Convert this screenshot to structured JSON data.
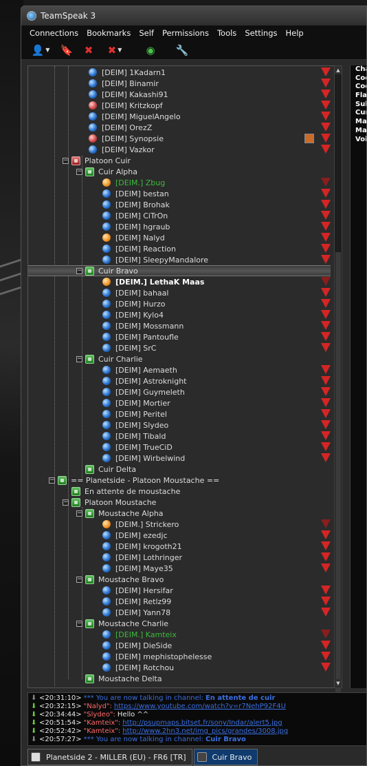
{
  "window": {
    "title": "TeamSpeak 3"
  },
  "menu": [
    "Connections",
    "Bookmarks",
    "Self",
    "Permissions",
    "Tools",
    "Settings",
    "Help"
  ],
  "toolbar": [
    {
      "name": "connect-icon",
      "glyph": "👤",
      "dropdown": true
    },
    {
      "name": "bookmark-icon",
      "glyph": "🔖",
      "dropdown": false
    },
    {
      "name": "disconnect-icon",
      "glyph": "✖",
      "dropdown": false
    },
    {
      "name": "disconnect-all-icon",
      "glyph": "✖",
      "dropdown": true
    },
    {
      "name": "away-icon",
      "glyph": "◉",
      "dropdown": false
    },
    {
      "name": "user-settings-icon",
      "glyph": "🔧",
      "dropdown": false
    }
  ],
  "tree": [
    {
      "type": "user",
      "level": 4,
      "label": "[DEIM] 1Kadarn1",
      "icon": "blue",
      "flag": true
    },
    {
      "type": "user",
      "level": 4,
      "label": "[DEIM] Binamir",
      "icon": "blue",
      "flag": true
    },
    {
      "type": "user",
      "level": 4,
      "label": "[DEIM] Kakashi91",
      "icon": "blue",
      "flag": true
    },
    {
      "type": "user",
      "level": 4,
      "label": "[DEIM] Kritzkopf",
      "icon": "away",
      "flag": true
    },
    {
      "type": "user",
      "level": 4,
      "label": "[DEIM] MiguelAngelo",
      "icon": "blue",
      "flag": true
    },
    {
      "type": "user",
      "level": 4,
      "label": "[DEIM] OrezZ",
      "icon": "blue",
      "flag": true
    },
    {
      "type": "user",
      "level": 4,
      "label": "[DEIM] Synopsie",
      "icon": "away",
      "flag": true,
      "badge": true
    },
    {
      "type": "user",
      "level": 4,
      "label": "[DEIM] Vazkor",
      "icon": "blue",
      "flag": true
    },
    {
      "type": "channel",
      "level": 2,
      "label": "Platoon Cuir",
      "icon": "red",
      "expanded": true
    },
    {
      "type": "channel",
      "level": 3,
      "label": "Cuir Alpha",
      "icon": "green",
      "expanded": true
    },
    {
      "type": "user",
      "level": 5,
      "label": "[DEIM.] Zbug",
      "icon": "orange",
      "flag": true,
      "style": "green",
      "flagdark": true
    },
    {
      "type": "user",
      "level": 5,
      "label": "[DEIM] bestan",
      "icon": "blue",
      "flag": true
    },
    {
      "type": "user",
      "level": 5,
      "label": "[DEIM] Brohak",
      "icon": "blue",
      "flag": true
    },
    {
      "type": "user",
      "level": 5,
      "label": "[DEIM] CiTrOn",
      "icon": "blue",
      "flag": true
    },
    {
      "type": "user",
      "level": 5,
      "label": "[DEIM] hgraub",
      "icon": "blue",
      "flag": true
    },
    {
      "type": "user",
      "level": 5,
      "label": "[DEIM] Nalyd",
      "icon": "orange",
      "flag": true
    },
    {
      "type": "user",
      "level": 5,
      "label": "[DEIM] Reaction",
      "icon": "blue",
      "flag": true
    },
    {
      "type": "user",
      "level": 5,
      "label": "[DEIM] SleepyMandalore",
      "icon": "blue",
      "flag": true
    },
    {
      "type": "channel",
      "level": 3,
      "label": "Cuir Bravo",
      "icon": "green",
      "expanded": true,
      "selected": true
    },
    {
      "type": "user",
      "level": 5,
      "label": "[DEIM.] LethaK Maas",
      "icon": "orange",
      "flag": true,
      "style": "bold",
      "flagdark": true
    },
    {
      "type": "user",
      "level": 5,
      "label": "[DEIM] bahaal",
      "icon": "blue",
      "flag": true
    },
    {
      "type": "user",
      "level": 5,
      "label": "[DEIM] Hurzo",
      "icon": "blue",
      "flag": true
    },
    {
      "type": "user",
      "level": 5,
      "label": "[DEIM] Kylo4",
      "icon": "blue",
      "flag": true
    },
    {
      "type": "user",
      "level": 5,
      "label": "[DEIM] Mossmann",
      "icon": "blue",
      "flag": true
    },
    {
      "type": "user",
      "level": 5,
      "label": "[DEIM] Pantoufle",
      "icon": "blue",
      "flag": true
    },
    {
      "type": "user",
      "level": 5,
      "label": "[DEIM] SrC",
      "icon": "blue",
      "flag": true
    },
    {
      "type": "channel",
      "level": 3,
      "label": "Cuir Charlie",
      "icon": "green",
      "expanded": true
    },
    {
      "type": "user",
      "level": 5,
      "label": "[DEIM] Aemaeth",
      "icon": "blue",
      "flag": true
    },
    {
      "type": "user",
      "level": 5,
      "label": "[DEIM] Astroknight",
      "icon": "blue",
      "flag": true
    },
    {
      "type": "user",
      "level": 5,
      "label": "[DEIM] Guymeleth",
      "icon": "blue",
      "flag": true
    },
    {
      "type": "user",
      "level": 5,
      "label": "[DEIM] Mortier",
      "icon": "blue",
      "flag": true
    },
    {
      "type": "user",
      "level": 5,
      "label": "[DEIM] Peritel",
      "icon": "blue",
      "flag": true
    },
    {
      "type": "user",
      "level": 5,
      "label": "[DEIM] Slydeo",
      "icon": "blue",
      "flag": true
    },
    {
      "type": "user",
      "level": 5,
      "label": "[DEIM] Tibald",
      "icon": "blue",
      "flag": true
    },
    {
      "type": "user",
      "level": 5,
      "label": "[DEIM] TrueCiD",
      "icon": "blue",
      "flag": true
    },
    {
      "type": "user",
      "level": 5,
      "label": "[DEIM] Wirbelwind",
      "icon": "blue",
      "flag": true
    },
    {
      "type": "channel",
      "level": 3,
      "label": "Cuir Delta",
      "icon": "green",
      "leaf": true
    },
    {
      "type": "channel",
      "level": 1,
      "label": "== Planetside - Platoon Moustache ==",
      "icon": "green",
      "expanded": true
    },
    {
      "type": "channel",
      "level": 2,
      "label": "En attente de moustache",
      "icon": "green",
      "leaf": true
    },
    {
      "type": "channel",
      "level": 2,
      "label": "Platoon Moustache",
      "icon": "green",
      "expanded": true
    },
    {
      "type": "channel",
      "level": 3,
      "label": "Moustache Alpha",
      "icon": "green",
      "expanded": true
    },
    {
      "type": "user",
      "level": 5,
      "label": "[DEIM.] Strickero",
      "icon": "orange",
      "flag": true,
      "flagdark": true
    },
    {
      "type": "user",
      "level": 5,
      "label": "[DEIM] ezedjc",
      "icon": "blue",
      "flag": true
    },
    {
      "type": "user",
      "level": 5,
      "label": "[DEIM] krogoth21",
      "icon": "blue",
      "flag": true
    },
    {
      "type": "user",
      "level": 5,
      "label": "[DEIM] Lothringer",
      "icon": "blue",
      "flag": true
    },
    {
      "type": "user",
      "level": 5,
      "label": "[DEIM] Maye35",
      "icon": "blue",
      "flag": true
    },
    {
      "type": "channel",
      "level": 3,
      "label": "Moustache Bravo",
      "icon": "green",
      "expanded": true
    },
    {
      "type": "user",
      "level": 5,
      "label": "[DEIM] Hersifar",
      "icon": "blue",
      "flag": true
    },
    {
      "type": "user",
      "level": 5,
      "label": "[DEIM] Retlz99",
      "icon": "blue",
      "flag": true
    },
    {
      "type": "user",
      "level": 5,
      "label": "[DEIM] Yann78",
      "icon": "blue",
      "flag": true
    },
    {
      "type": "channel",
      "level": 3,
      "label": "Moustache Charlie",
      "icon": "green",
      "expanded": true
    },
    {
      "type": "user",
      "level": 5,
      "label": "[DEIM.] Kamteix",
      "icon": "blue",
      "flag": true,
      "style": "green",
      "flagdark": true
    },
    {
      "type": "user",
      "level": 5,
      "label": "[DEIM] DieSide",
      "icon": "blue",
      "flag": true
    },
    {
      "type": "user",
      "level": 5,
      "label": "[DEIM] mephistophelesse",
      "icon": "blue",
      "flag": true
    },
    {
      "type": "user",
      "level": 5,
      "label": "[DEIM] Rotchou",
      "icon": "blue",
      "flag": true
    },
    {
      "type": "channel",
      "level": 3,
      "label": "Moustache Delta",
      "icon": "green",
      "leaf": true
    }
  ],
  "info_panel": [
    "Cha",
    "Coc",
    "Coc",
    "Flac",
    "Sub",
    "Cur",
    "Ma",
    "Ma",
    "Voi"
  ],
  "chat_log": [
    {
      "arrow": "gray",
      "time": "<20:31:10>",
      "kind": "sys",
      "text": "*** You are now talking in channel:",
      "channel": "En attente de cuir"
    },
    {
      "arrow": "green",
      "time": "<20:32:15>",
      "nick": "\"Nalyd\":",
      "kind": "link",
      "text": "https://www.youtube.com/watch?v=r7NehP92F4U"
    },
    {
      "arrow": "green",
      "time": "<20:34:44>",
      "nick": "\"Slydeo\":",
      "kind": "msg",
      "text": "Hello ^^"
    },
    {
      "arrow": "green",
      "time": "<20:51:54>",
      "nick": "\"Kamteix\":",
      "kind": "link",
      "text": "http://psupmaps.bitset.fr/sony/Indar/alert5.jpg"
    },
    {
      "arrow": "green",
      "time": "<20:52:42>",
      "nick": "\"Kamteix\":",
      "kind": "link",
      "text": "http://www.2hn3.net/img_pics/grandes/3008.jpg"
    },
    {
      "arrow": "gray",
      "time": "<20:57:27>",
      "kind": "sys",
      "text": "*** You are now talking in channel:",
      "channel": "Cuir Bravo"
    }
  ],
  "tabs": [
    {
      "label": "Planetside 2 -  MILLER (EU) - FR6 [TR]",
      "active": false,
      "icon": "server"
    },
    {
      "label": "Cuir Bravo",
      "active": true,
      "icon": "chat"
    }
  ]
}
